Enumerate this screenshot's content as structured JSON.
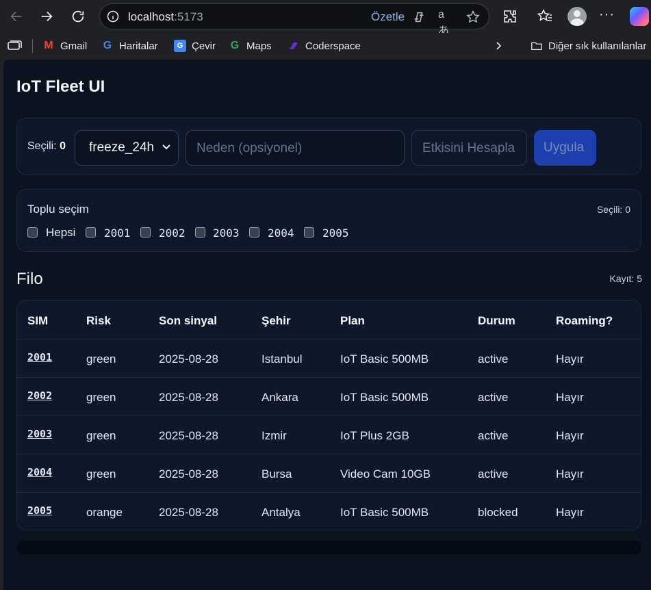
{
  "browser": {
    "url_host": "localhost",
    "url_port": ":5173",
    "summarize_label": "Özetle",
    "bookmarks": [
      {
        "label": "Gmail"
      },
      {
        "label": "Haritalar"
      },
      {
        "label": "Çevir"
      },
      {
        "label": "Maps"
      },
      {
        "label": "Coderspace"
      }
    ],
    "other_bookmarks": "Diğer sık kullanılanlar"
  },
  "app": {
    "title": "IoT Fleet UI"
  },
  "action_bar": {
    "selected_label": "Seçili:",
    "selected_count": "0",
    "action_value": "freeze_24h",
    "reason_placeholder": "Neden (opsiyonel)",
    "calc_label": "Etkisini Hesapla",
    "apply_label": "Uygula"
  },
  "bulk": {
    "title": "Toplu seçim",
    "count_text": "Seçili: 0",
    "all_label": "Hepsi",
    "options": [
      "2001",
      "2002",
      "2003",
      "2004",
      "2005"
    ]
  },
  "fleet": {
    "title": "Filo",
    "count_text": "Kayıt: 5",
    "columns": [
      "SIM",
      "Risk",
      "Son sinyal",
      "Şehir",
      "Plan",
      "Durum",
      "Roaming?"
    ],
    "rows": [
      {
        "sim": "2001",
        "risk": "green",
        "last_signal": "2025-08-28",
        "city": "Istanbul",
        "plan": "IoT Basic 500MB",
        "status": "active",
        "roaming": "Hayır"
      },
      {
        "sim": "2002",
        "risk": "green",
        "last_signal": "2025-08-28",
        "city": "Ankara",
        "plan": "IoT Basic 500MB",
        "status": "active",
        "roaming": "Hayır"
      },
      {
        "sim": "2003",
        "risk": "green",
        "last_signal": "2025-08-28",
        "city": "Izmir",
        "plan": "IoT Plus 2GB",
        "status": "active",
        "roaming": "Hayır"
      },
      {
        "sim": "2004",
        "risk": "green",
        "last_signal": "2025-08-28",
        "city": "Bursa",
        "plan": "Video Cam 10GB",
        "status": "active",
        "roaming": "Hayır"
      },
      {
        "sim": "2005",
        "risk": "orange",
        "last_signal": "2025-08-28",
        "city": "Antalya",
        "plan": "IoT Basic 500MB",
        "status": "blocked",
        "roaming": "Hayır"
      }
    ]
  }
}
